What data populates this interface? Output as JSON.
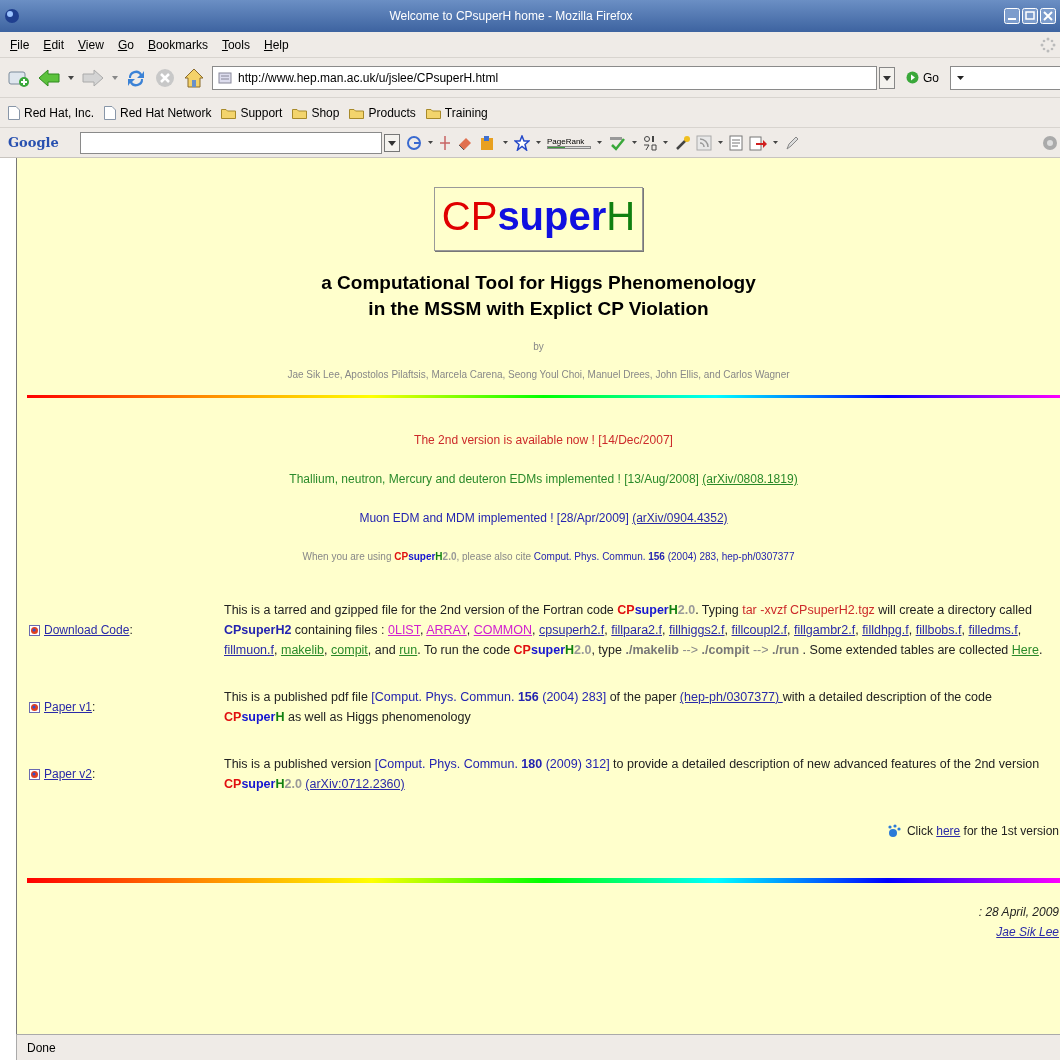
{
  "window": {
    "title": "Welcome to CPsuperH home - Mozilla Firefox"
  },
  "menu": [
    {
      "label": "File"
    },
    {
      "label": "Edit"
    },
    {
      "label": "View"
    },
    {
      "label": "Go"
    },
    {
      "label": "Bookmarks"
    },
    {
      "label": "Tools"
    },
    {
      "label": "Help"
    }
  ],
  "address_bar": {
    "url": "http://www.hep.man.ac.uk/u/jslee/CPsuperH.html",
    "go_label": "Go"
  },
  "bookmarks": [
    {
      "label": "Red Hat, Inc.",
      "kind": "page"
    },
    {
      "label": "Red Hat Network",
      "kind": "page"
    },
    {
      "label": "Support",
      "kind": "folder"
    },
    {
      "label": "Shop",
      "kind": "folder"
    },
    {
      "label": "Products",
      "kind": "folder"
    },
    {
      "label": "Training",
      "kind": "folder"
    }
  ],
  "google_toolbar": {
    "logo": "Google",
    "pagerank": "PageRank"
  },
  "page": {
    "logo": [
      {
        "text": "CP",
        "kind": "red"
      },
      {
        "text": "super",
        "kind": "blue"
      },
      {
        "text": "H",
        "kind": "green"
      }
    ],
    "heading": [
      "a Computational Tool for Higgs Phenomenology",
      "in the MSSM with Explict CP Violation"
    ],
    "by": "by",
    "authors": "Jae Sik Lee, Apostolos Pilaftsis, Marcela Carena, Seong Youl Choi, Manuel Drees, John Ellis, and Carlos Wagner",
    "news": [
      {
        "kind": "news",
        "runs": [
          {
            "text": "The 2nd version is available now ! [14/Dec/2007]",
            "kind": "red"
          }
        ]
      },
      {
        "kind": "news",
        "runs": [
          {
            "text": "Thallium, neutron, Mercury and deuteron EDMs implemented ! [13/Aug/2008] ",
            "kind": "green"
          },
          {
            "text": "(arXiv/0808.1819) ",
            "kind": "link-green"
          }
        ]
      },
      {
        "kind": "news",
        "runs": [
          {
            "text": "Muon EDM and MDM implemented ! [28/Apr/2009] ",
            "kind": "blue"
          },
          {
            "text": "(arXiv/0904.4352) ",
            "kind": "link"
          }
        ]
      },
      {
        "kind": "citation",
        "runs": [
          {
            "text": "When you are using ",
            "kind": "gray"
          },
          {
            "text": "CP",
            "kind": "cp"
          },
          {
            "text": "super",
            "kind": "super"
          },
          {
            "text": "H",
            "kind": "h"
          },
          {
            "text": "2.0",
            "kind": "ver"
          },
          {
            "text": ", please also cite ",
            "kind": "gray"
          },
          {
            "text": "Comput. Phys. Commun. ",
            "kind": "blue"
          },
          {
            "text": "156",
            "kind": "blue-bold"
          },
          {
            "text": " (2004) 283, hep-ph/0307377",
            "kind": "blue"
          }
        ]
      }
    ],
    "rows": [
      {
        "label": "Download Code",
        "suffix": ":",
        "runs": [
          {
            "text": "This is a tarred and gzipped file for the 2nd version of the Fortran code ",
            "kind": "text"
          },
          {
            "text": "CP",
            "kind": "cp"
          },
          {
            "text": "super",
            "kind": "super"
          },
          {
            "text": "H",
            "kind": "h"
          },
          {
            "text": "2.0",
            "kind": "ver"
          },
          {
            "text": ". Typing ",
            "kind": "text"
          },
          {
            "text": "tar -xvzf CPsuperH2.tgz",
            "kind": "red"
          },
          {
            "text": " will create a directory called ",
            "kind": "text"
          },
          {
            "text": "CPsuperH2",
            "kind": "blue-bold"
          },
          {
            "text": " containing files : ",
            "kind": "text"
          },
          {
            "text": "0LIST",
            "kind": "link-magenta"
          },
          {
            "text": ", ",
            "kind": "text"
          },
          {
            "text": "ARRAY",
            "kind": "link-magenta"
          },
          {
            "text": ", ",
            "kind": "text"
          },
          {
            "text": "COMMON",
            "kind": "link-magenta"
          },
          {
            "text": ", ",
            "kind": "text"
          },
          {
            "text": "cpsuperh2.f",
            "kind": "link"
          },
          {
            "text": ", ",
            "kind": "text"
          },
          {
            "text": "fillpara2.f",
            "kind": "link"
          },
          {
            "text": ", ",
            "kind": "text"
          },
          {
            "text": "fillhiggs2.f",
            "kind": "link"
          },
          {
            "text": ", ",
            "kind": "text"
          },
          {
            "text": "fillcoupl2.f",
            "kind": "link"
          },
          {
            "text": ", ",
            "kind": "text"
          },
          {
            "text": "fillgambr2.f",
            "kind": "link"
          },
          {
            "text": ", ",
            "kind": "text"
          },
          {
            "text": "filldhpg.f",
            "kind": "link"
          },
          {
            "text": ", ",
            "kind": "text"
          },
          {
            "text": "fillbobs.f",
            "kind": "link"
          },
          {
            "text": ", ",
            "kind": "text"
          },
          {
            "text": "filledms.f",
            "kind": "link"
          },
          {
            "text": ", ",
            "kind": "text"
          },
          {
            "text": "fillmuon.f",
            "kind": "link"
          },
          {
            "text": ", ",
            "kind": "text"
          },
          {
            "text": "makelib",
            "kind": "link-green"
          },
          {
            "text": ", ",
            "kind": "text"
          },
          {
            "text": "compit",
            "kind": "link-green"
          },
          {
            "text": ", and ",
            "kind": "text"
          },
          {
            "text": "run",
            "kind": "link-green"
          },
          {
            "text": ". To run the code ",
            "kind": "text"
          },
          {
            "text": "CP",
            "kind": "cp"
          },
          {
            "text": "super",
            "kind": "super"
          },
          {
            "text": "H",
            "kind": "h"
          },
          {
            "text": "2.0",
            "kind": "ver"
          },
          {
            "text": ", type ",
            "kind": "text"
          },
          {
            "text": "./makelib",
            "kind": "cmd"
          },
          {
            "text": " --> ",
            "kind": "gray"
          },
          {
            "text": "./compit",
            "kind": "cmd"
          },
          {
            "text": " --> ",
            "kind": "gray"
          },
          {
            "text": "./run",
            "kind": "cmd"
          },
          {
            "text": " . Some extended tables are collected ",
            "kind": "text"
          },
          {
            "text": "Here",
            "kind": "link-green"
          },
          {
            "text": ".",
            "kind": "text"
          }
        ]
      },
      {
        "label": "Paper v1",
        "suffix": ":",
        "runs": [
          {
            "text": "This is a published pdf file ",
            "kind": "text"
          },
          {
            "text": "[Comput. Phys. Commun. ",
            "kind": "blue"
          },
          {
            "text": "156",
            "kind": "blue-bold"
          },
          {
            "text": " (2004) 283]",
            "kind": "blue"
          },
          {
            "text": " of the paper ",
            "kind": "text"
          },
          {
            "text": "(hep-ph/0307377) ",
            "kind": "link"
          },
          {
            "text": "with a detailed description of the code ",
            "kind": "text"
          },
          {
            "text": "CP",
            "kind": "cp"
          },
          {
            "text": "super",
            "kind": "super"
          },
          {
            "text": "H",
            "kind": "h"
          },
          {
            "text": " as well as Higgs phenomenology",
            "kind": "text"
          }
        ]
      },
      {
        "label": "Paper v2",
        "suffix": ":",
        "runs": [
          {
            "text": "This is a published version ",
            "kind": "text"
          },
          {
            "text": "[Comput. Phys. Commun. ",
            "kind": "blue"
          },
          {
            "text": "180",
            "kind": "blue-bold"
          },
          {
            "text": " (2009) 312]",
            "kind": "blue"
          },
          {
            "text": " to provide a detailed description of new advanced features of the 2nd version ",
            "kind": "text"
          },
          {
            "text": "CP",
            "kind": "cp"
          },
          {
            "text": "super",
            "kind": "super"
          },
          {
            "text": "H",
            "kind": "h"
          },
          {
            "text": "2.0 ",
            "kind": "ver"
          },
          {
            "text": "(arXiv:0712.2360)",
            "kind": "link"
          }
        ]
      }
    ],
    "first_version": [
      {
        "text": "Click ",
        "kind": "text"
      },
      {
        "text": "here",
        "kind": "link"
      },
      {
        "text": " for the 1st version",
        "kind": "text"
      }
    ],
    "updated": ": 28 April, 2009",
    "author_link": "Jae Sik Lee"
  },
  "status_bar": {
    "text": "Done"
  }
}
